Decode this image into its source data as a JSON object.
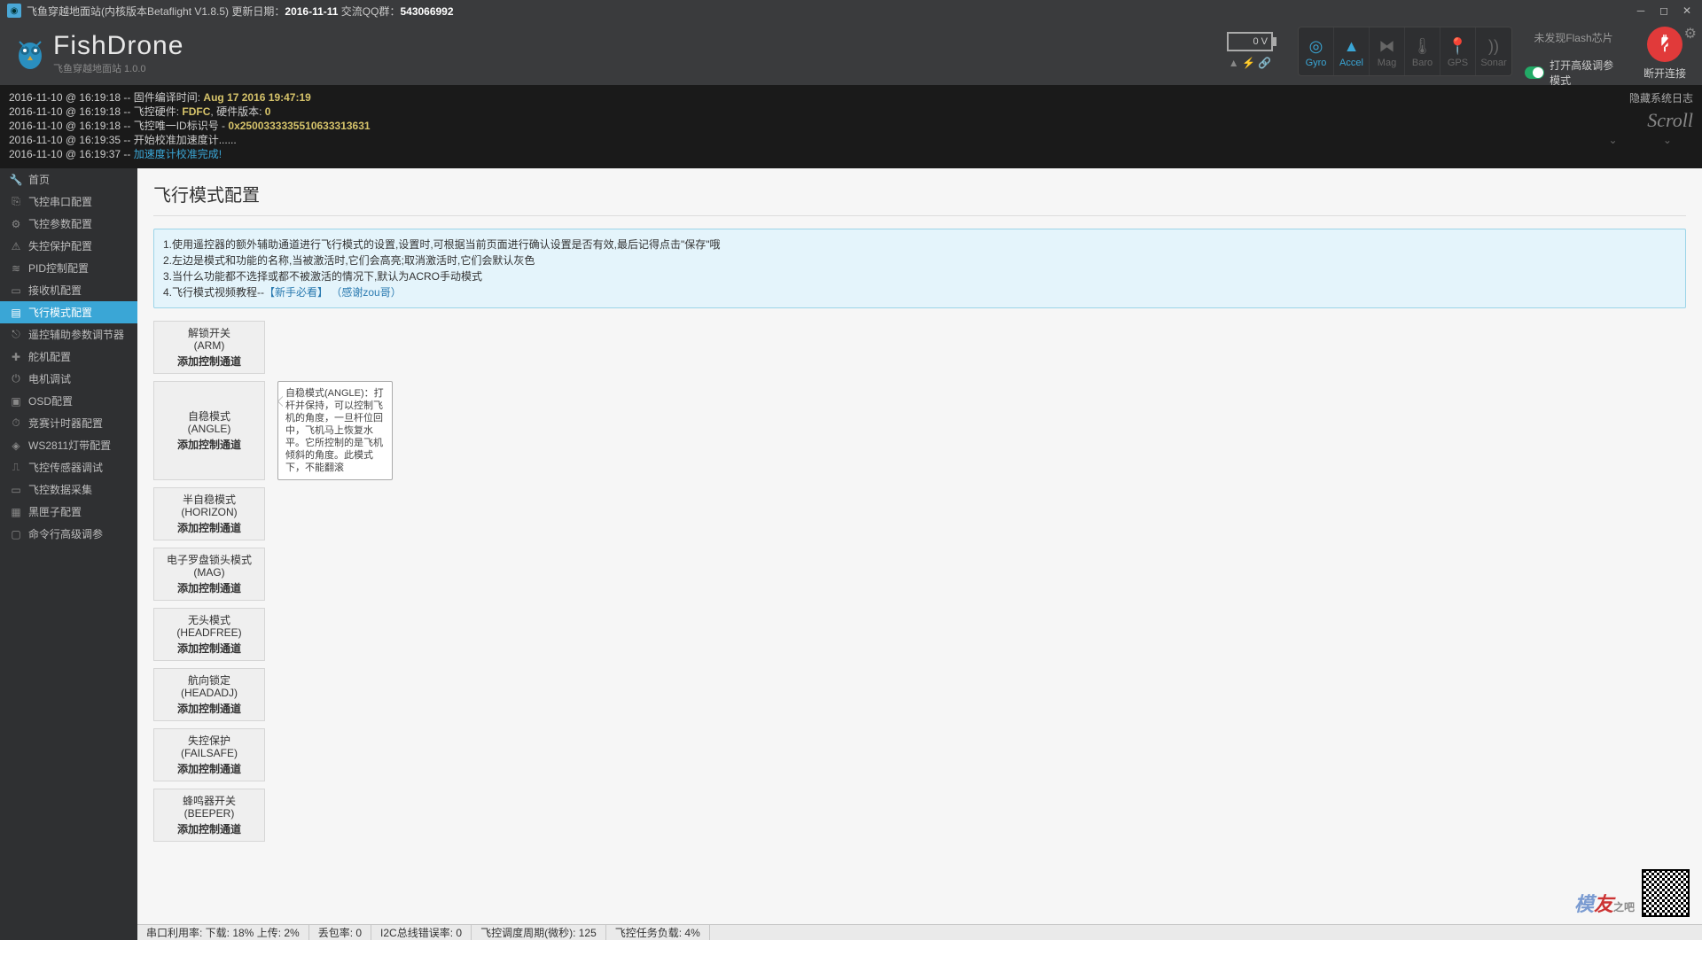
{
  "titlebar": {
    "text_prefix": "飞鱼穿越地面站(内核版本Betaflight V1.8.5)   更新日期：",
    "date": "2016-11-11",
    "qq_label": " 交流QQ群：",
    "qq": "543066992"
  },
  "brand": {
    "name": "FishDrone",
    "sub": "飞鱼穿越地面站   1.0.0"
  },
  "header": {
    "battery": "0 V",
    "sensors": [
      {
        "label": "Gyro",
        "on": true
      },
      {
        "label": "Accel",
        "on": true
      },
      {
        "label": "Mag",
        "on": false
      },
      {
        "label": "Baro",
        "on": false
      },
      {
        "label": "GPS",
        "on": false
      },
      {
        "label": "Sonar",
        "on": false
      }
    ],
    "flash_note": "未发现Flash芯片",
    "expert": "打开高级调参模式",
    "connect": "断开连接"
  },
  "log": {
    "hide": "隐藏系统日志",
    "scroll": "Scroll",
    "lines": [
      {
        "ts": "2016-11-10 @ 16:19:18",
        "sep": " -- ",
        "txt": "固件编译时间: ",
        "b": "Aug 17 2016 19:47:19"
      },
      {
        "ts": "2016-11-10 @ 16:19:18",
        "sep": " -- ",
        "txt": "飞控硬件: ",
        "b": "FDFC",
        "tail": ", 硬件版本: ",
        "b2": "0"
      },
      {
        "ts": "2016-11-10 @ 16:19:18",
        "sep": " -- ",
        "txt": "飞控唯一ID标识号 - ",
        "b": "0x2500333335510633313631"
      },
      {
        "ts": "2016-11-10 @ 16:19:35",
        "sep": " -- ",
        "txt": "开始校准加速度计......"
      },
      {
        "ts": "2016-11-10 @ 16:19:37",
        "sep": " -- ",
        "link": "加速度计校准完成!"
      }
    ]
  },
  "sidebar": [
    {
      "label": "首页",
      "ico": "🔧"
    },
    {
      "label": "飞控串口配置",
      "ico": "⎘"
    },
    {
      "label": "飞控参数配置",
      "ico": "⚙"
    },
    {
      "label": "失控保护配置",
      "ico": "⚠"
    },
    {
      "label": "PID控制配置",
      "ico": "≋"
    },
    {
      "label": "接收机配置",
      "ico": "▭"
    },
    {
      "label": "飞行模式配置",
      "ico": "▤",
      "active": true
    },
    {
      "label": "遥控辅助参数调节器",
      "ico": "⎋"
    },
    {
      "label": "舵机配置",
      "ico": "✚"
    },
    {
      "label": "电机调试",
      "ico": "⏻"
    },
    {
      "label": "OSD配置",
      "ico": "▣"
    },
    {
      "label": "竞赛计时器配置",
      "ico": "⏱"
    },
    {
      "label": "WS2811灯带配置",
      "ico": "◈"
    },
    {
      "label": "飞控传感器调试",
      "ico": "⎍"
    },
    {
      "label": "飞控数据采集",
      "ico": "▭"
    },
    {
      "label": "黑匣子配置",
      "ico": "▦"
    },
    {
      "label": "命令行高级调参",
      "ico": "▢"
    }
  ],
  "page": {
    "title": "飞行模式配置",
    "notice": {
      "l1": "1.使用遥控器的额外辅助通道进行飞行模式的设置,设置时,可根据当前页面进行确认设置是否有效,最后记得点击\"保存\"哦",
      "l2": "2.左边是模式和功能的名称,当被激活时,它们会高亮;取消激活时,它们会默认灰色",
      "l3": "3.当什么功能都不选择或都不被激活的情况下,默认为ACRO手动模式",
      "l4a": "4.飞行模式视频教程--",
      "l4b": "【新手必看】 （感谢zou哥）"
    },
    "add_label": "添加控制通道",
    "tooltip": "自稳模式(ANGLE)：打杆并保持，可以控制飞机的角度，一旦杆位回中，飞机马上恢复水平。它所控制的是飞机倾斜的角度。此模式下，不能翻滚",
    "modes": [
      {
        "name": "解锁开关",
        "en": "(ARM)"
      },
      {
        "name": "自稳模式",
        "en": "(ANGLE)",
        "tooltip": true
      },
      {
        "name": "半自稳模式",
        "en": "(HORIZON)"
      },
      {
        "name": "电子罗盘锁头模式",
        "en": "(MAG)"
      },
      {
        "name": "无头模式",
        "en": "(HEADFREE)"
      },
      {
        "name": "航向锁定",
        "en": "(HEADADJ)"
      },
      {
        "name": "失控保护",
        "en": "(FAILSAFE)"
      },
      {
        "name": "蜂鸣器开关",
        "en": "(BEEPER)"
      }
    ]
  },
  "statusbar": {
    "s1": "串口利用率: 下载: 18% 上传: 2%",
    "s2": "丢包率: 0",
    "s3": "I2C总线错误率: 0",
    "s4": "飞控调度周期(微秒): 125",
    "s5": "飞控任务负载: 4%"
  }
}
